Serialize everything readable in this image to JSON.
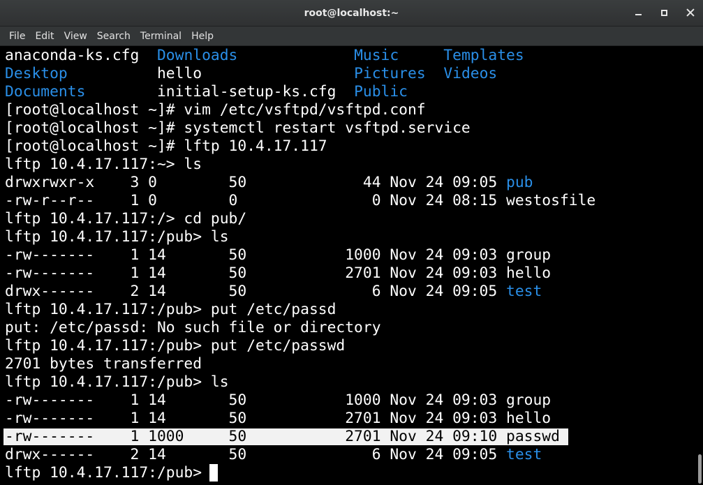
{
  "window": {
    "title": "root@localhost:~"
  },
  "menu": {
    "items": [
      "File",
      "Edit",
      "View",
      "Search",
      "Terminal",
      "Help"
    ]
  },
  "colors": {
    "background": "#000000",
    "text": "#ffffff",
    "directory": "#2a8fe8",
    "selection": "#f2f2f2"
  },
  "terminal": {
    "lines": [
      [
        {
          "t": "anaconda-ks.cfg  "
        },
        {
          "t": "Downloads",
          "c": "dir"
        },
        {
          "t": "             "
        },
        {
          "t": "Music",
          "c": "dir"
        },
        {
          "t": "     "
        },
        {
          "t": "Templates",
          "c": "dir"
        }
      ],
      [
        {
          "t": "Desktop",
          "c": "dir"
        },
        {
          "t": "          hello                 "
        },
        {
          "t": "Pictures",
          "c": "dir"
        },
        {
          "t": "  "
        },
        {
          "t": "Videos",
          "c": "dir"
        }
      ],
      [
        {
          "t": "Documents",
          "c": "dir"
        },
        {
          "t": "        initial-setup-ks.cfg  "
        },
        {
          "t": "Public",
          "c": "dir"
        }
      ],
      [
        {
          "t": "[root@localhost ~]# vim /etc/vsftpd/vsftpd.conf"
        }
      ],
      [
        {
          "t": "[root@localhost ~]# systemctl restart vsftpd.service"
        }
      ],
      [
        {
          "t": "[root@localhost ~]# lftp 10.4.17.117"
        }
      ],
      [
        {
          "t": "lftp 10.4.17.117:~> ls"
        }
      ],
      [
        {
          "t": "drwxrwxr-x    3 0        50             44 Nov 24 09:05 "
        },
        {
          "t": "pub",
          "c": "dir"
        }
      ],
      [
        {
          "t": "-rw-r--r--    1 0        0               0 Nov 24 08:15 westosfile"
        }
      ],
      [
        {
          "t": "lftp 10.4.17.117:/> cd pub/"
        }
      ],
      [
        {
          "t": "lftp 10.4.17.117:/pub> ls"
        }
      ],
      [
        {
          "t": "-rw-------    1 14       50           1000 Nov 24 09:03 group"
        }
      ],
      [
        {
          "t": "-rw-------    1 14       50           2701 Nov 24 09:03 hello"
        }
      ],
      [
        {
          "t": "drwx------    2 14       50              6 Nov 24 09:05 "
        },
        {
          "t": "test",
          "c": "dir"
        }
      ],
      [
        {
          "t": "lftp 10.4.17.117:/pub> put /etc/passd"
        }
      ],
      [
        {
          "t": "put: /etc/passd: No such file or directory"
        }
      ],
      [
        {
          "t": "lftp 10.4.17.117:/pub> put /etc/passwd"
        }
      ],
      [
        {
          "t": "2701 bytes transferred"
        }
      ],
      [
        {
          "t": "lftp 10.4.17.117:/pub> ls"
        }
      ],
      [
        {
          "t": "-rw-------    1 14       50           1000 Nov 24 09:03 group"
        }
      ],
      [
        {
          "t": "-rw-------    1 14       50           2701 Nov 24 09:03 hello"
        }
      ],
      [
        {
          "t": "-rw-------    1 1000     50           2701 Nov 24 09:10 passwd",
          "c": "sel"
        }
      ],
      [
        {
          "t": "drwx------    2 14       50              6 Nov 24 09:05 "
        },
        {
          "t": "test",
          "c": "dir"
        }
      ],
      [
        {
          "t": "lftp 10.4.17.117:/pub> "
        }
      ]
    ]
  }
}
